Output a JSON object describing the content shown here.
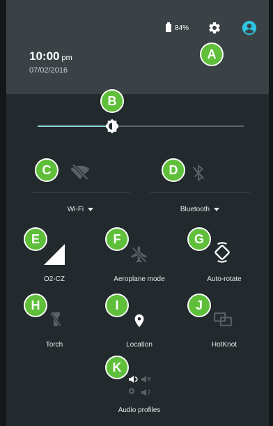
{
  "status": {
    "battery_percent": "84%",
    "icons": [
      "battery-icon",
      "settings-gear-icon",
      "user-account-icon"
    ]
  },
  "clock": {
    "time": "10:00",
    "ampm": "pm",
    "date": "07/02/2016"
  },
  "brightness": {
    "level_fraction": 0.36
  },
  "tiles": {
    "wifi": {
      "label": "Wi-Fi",
      "icon": "wifi-off-icon"
    },
    "bluetooth": {
      "label": "Bluetooth",
      "icon": "bluetooth-off-icon"
    },
    "mobile": {
      "label": "O2-CZ",
      "icon": "signal-icon"
    },
    "aeroplane": {
      "label": "Aeroplane mode",
      "icon": "airplane-icon"
    },
    "autorotate": {
      "label": "Auto-rotate",
      "icon": "rotate-icon"
    },
    "torch": {
      "label": "Torch",
      "icon": "torch-icon"
    },
    "location": {
      "label": "Location",
      "icon": "location-pin-icon"
    },
    "hotknot": {
      "label": "HotKnot",
      "icon": "hotknot-icon"
    },
    "audio": {
      "label": "Audio profiles",
      "icon": "audio-profiles-icon"
    }
  },
  "markers": [
    "A",
    "B",
    "C",
    "D",
    "E",
    "F",
    "G",
    "H",
    "I",
    "J",
    "K"
  ],
  "colors": {
    "accent": "#8ed8d8",
    "marker_green": "#5fbf3a",
    "panel_bg": "#232a2d",
    "header_bg": "#3a4246",
    "avatar": "#2ec4e0"
  }
}
